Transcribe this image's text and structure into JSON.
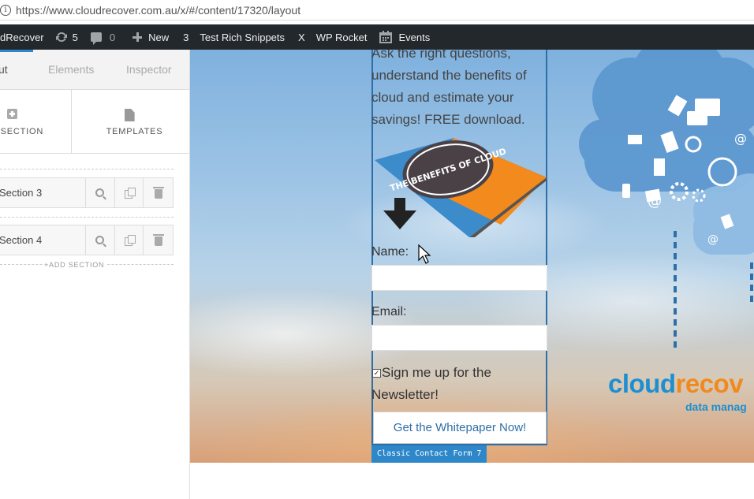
{
  "browser": {
    "url": "https://www.cloudrecover.com.au/x/#/content/17320/layout"
  },
  "adminbar": {
    "site_name": "dRecover",
    "updates_count": "5",
    "comments_count": "0",
    "new_label": "New",
    "count_item": "3",
    "rich_snippets": "Test Rich Snippets",
    "x_item": "X",
    "wp_rocket": "WP Rocket",
    "events": "Events"
  },
  "sidebar": {
    "tabs": [
      {
        "label": "ut"
      },
      {
        "label": "Elements"
      },
      {
        "label": "Inspector"
      }
    ],
    "add_section_label": "D SECTION",
    "templates_label": "TEMPLATES",
    "sections": [
      {
        "name": "Section 3"
      },
      {
        "name": "Section 4"
      }
    ],
    "add_section_link": "+ADD SECTION"
  },
  "content": {
    "intro_text": "Ask the right questions, understand the benefits of cloud and estimate your savings! FREE download.",
    "booklet_title": "THE BENEFITS OF CLOUD",
    "name_label": "Name:",
    "email_label": "Email:",
    "newsletter_label": "Sign me up for the Newsletter!",
    "newsletter_checked": true,
    "submit_label": "Get the Whitepaper Now!",
    "element_tag": "Classic Contact Form 7",
    "logo_part1": "cloud",
    "logo_part2": "recov",
    "logo_tagline": "data manag"
  },
  "colors": {
    "admin_bar_bg": "#23282d",
    "accent": "#2d87c9",
    "logo_blue": "#1d8fd1",
    "logo_orange": "#f08a1e"
  },
  "icons": [
    "info-icon",
    "refresh-icon",
    "comment-icon",
    "plus-icon",
    "calendar-icon",
    "add-section-icon",
    "template-icon",
    "search-icon",
    "duplicate-icon",
    "trash-icon",
    "down-arrow-icon",
    "mouse-cursor-icon"
  ]
}
